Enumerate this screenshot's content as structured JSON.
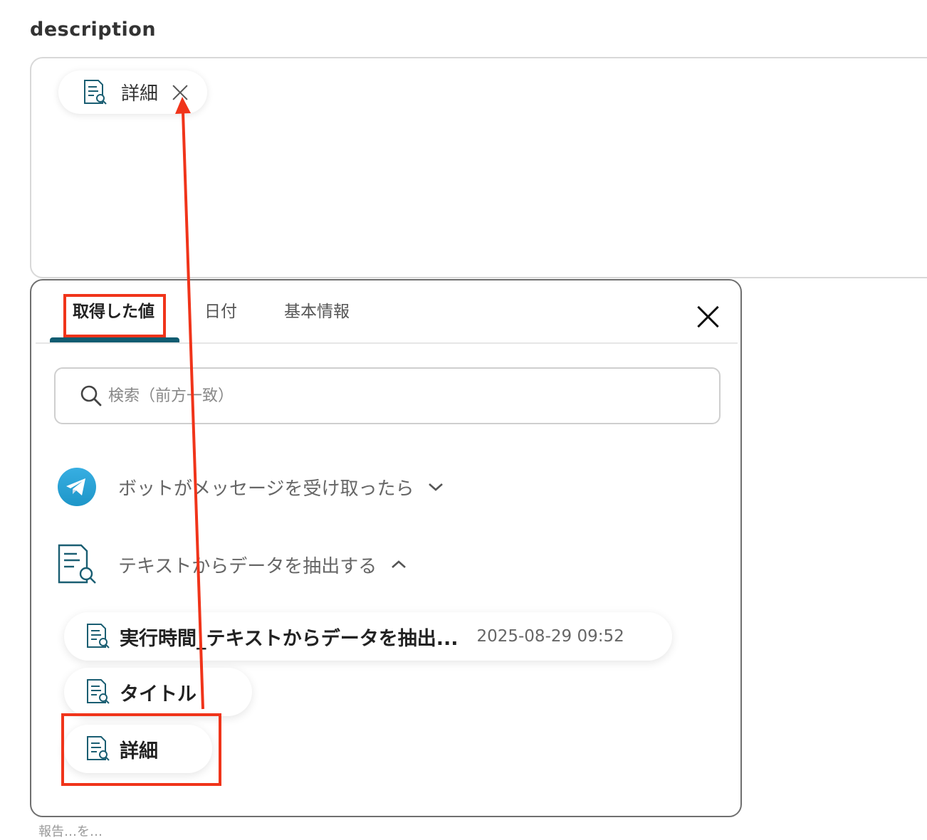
{
  "field": {
    "label": "description"
  },
  "selected_chip": {
    "label": "詳細",
    "icon": "document-search-icon"
  },
  "panel": {
    "tabs": [
      {
        "label": "取得した値",
        "active": true
      },
      {
        "label": "日付",
        "active": false
      },
      {
        "label": "基本情報",
        "active": false
      }
    ],
    "search": {
      "placeholder": "検索（前方一致）",
      "value": ""
    },
    "groups": [
      {
        "label": "ボットがメッセージを受け取ったら",
        "icon": "telegram-icon",
        "expanded": false
      },
      {
        "label": "テキストからデータを抽出する",
        "icon": "document-search-icon",
        "expanded": true
      }
    ],
    "values": [
      {
        "label": "実行時間_テキストからデータを抽出...",
        "date": "2025-08-29 09:52"
      },
      {
        "label": "タイトル",
        "date": ""
      },
      {
        "label": "詳細",
        "date": ""
      }
    ]
  },
  "colors": {
    "accent": "#0f5c71",
    "annotation": "#f0341a",
    "telegram": "#2aa3e0"
  },
  "bottom_hint": "報告…を…"
}
